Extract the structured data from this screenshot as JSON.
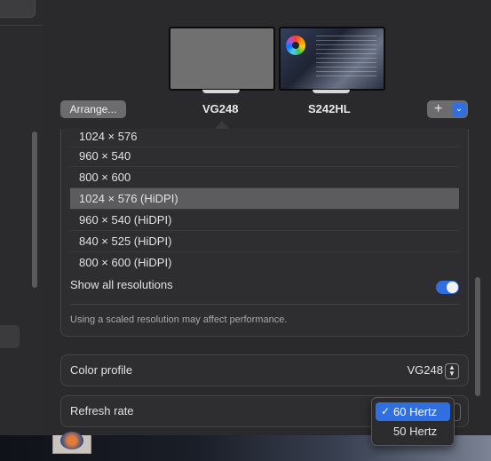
{
  "displays": {
    "arrange_label": "Arrange...",
    "display_a": {
      "name": "VG248"
    },
    "display_b": {
      "name": "S242HL"
    },
    "add_button_icon": "plus-icon",
    "add_button_menu_icon": "chevron-down-icon"
  },
  "resolutions": {
    "items": [
      {
        "label": "1024 × 576",
        "selected": false
      },
      {
        "label": "960 × 540",
        "selected": false
      },
      {
        "label": "800 × 600",
        "selected": false
      },
      {
        "label": "1024 × 576 (HiDPI)",
        "selected": true
      },
      {
        "label": "960 × 540 (HiDPI)",
        "selected": false
      },
      {
        "label": "840 × 525 (HiDPI)",
        "selected": false
      },
      {
        "label": "800 × 600 (HiDPI)",
        "selected": false
      }
    ],
    "show_all_label": "Show all resolutions",
    "show_all_enabled": true,
    "note": "Using a scaled resolution may affect performance."
  },
  "color_profile": {
    "label": "Color profile",
    "value": "VG248"
  },
  "refresh_rate": {
    "label": "Refresh rate",
    "options": [
      {
        "label": "60 Hertz",
        "selected": true
      },
      {
        "label": "50 Hertz",
        "selected": false
      }
    ],
    "check_glyph": "✓"
  },
  "colors": {
    "accent": "#2f6fe0",
    "selected_row": "#5c5c5e",
    "panel_bg": "#2a2a2c"
  }
}
